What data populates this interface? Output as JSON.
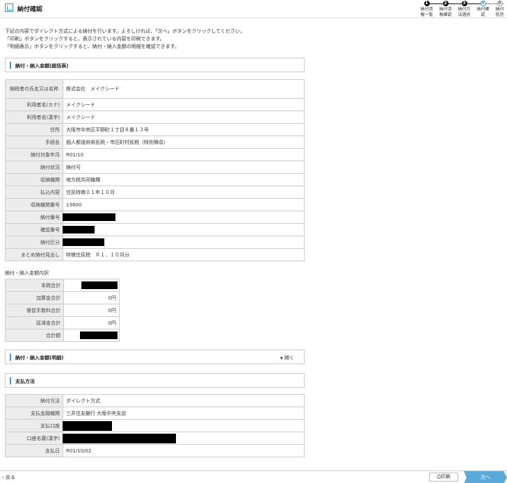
{
  "header": {
    "title": "納付確認"
  },
  "steps": [
    {
      "num": "1",
      "line1": "納付済",
      "line2": "報一覧"
    },
    {
      "num": "2",
      "line1": "納付済",
      "line2": "報確認"
    },
    {
      "num": "3",
      "line1": "納付方",
      "line2": "法選択"
    },
    {
      "num": "4",
      "line1": "納付確",
      "line2": "認"
    },
    {
      "num": "5",
      "line1": "納付",
      "line2": "低完"
    }
  ],
  "intro": {
    "line1": "下記の内容でダイレクト方式による納付を行います。よろしければ、「次へ」ボタンをクリックしてください。",
    "line2": "「印刷」ボタンをクリックすると、表示されている内容を印刷できます。",
    "line3": "「明細表示」ボタンをクリックすると、納付・納入金額の明細を確認できます。"
  },
  "section_summary": {
    "title": "納付・納入金額(総括表)"
  },
  "summary_rows": [
    {
      "label": "納税者の氏名又は名称",
      "value": "株式会社　メイクシード"
    },
    {
      "label": "利用者名(カナ)",
      "value": "メイクシード"
    },
    {
      "label": "利用者名(漢字)",
      "value": "メイクシード"
    },
    {
      "label": "住所",
      "value": "大阪市中央区平野町１丁目８番１３号"
    },
    {
      "label": "手続名",
      "value": "個人都道府県民税・市区町村民税（特別徴収）"
    },
    {
      "label": "納付対象年月",
      "value": "R01/10"
    },
    {
      "label": "納付状況",
      "value": "納付可"
    },
    {
      "label": "収納機関",
      "value": "地方税共同機構"
    },
    {
      "label": "払込内容",
      "value": "住民特徴０１年１０月"
    },
    {
      "label": "収納機関番号",
      "value": "13800"
    },
    {
      "label": "納付番号",
      "value": ""
    },
    {
      "label": "確認番号",
      "value": ""
    },
    {
      "label": "納付区分",
      "value": ""
    },
    {
      "label": "まとめ納付見出し",
      "value": "特徴住民税　Ｒ１．１０月分"
    }
  ],
  "breakdown": {
    "title": "納付・納入金額内訳",
    "rows": [
      {
        "label": "本税合計",
        "value": ""
      },
      {
        "label": "加算金合計",
        "value": "0円"
      },
      {
        "label": "督促手数料合計",
        "value": "0円"
      },
      {
        "label": "延滞金合計",
        "value": "0円"
      },
      {
        "label": "合計額",
        "value": ""
      }
    ]
  },
  "section_detail": {
    "title": "納付・納入金額(明細)",
    "toggle": "開く"
  },
  "section_payment": {
    "title": "支払方法"
  },
  "payment_rows": [
    {
      "label": "納付方法",
      "value": "ダイレクト方式"
    },
    {
      "label": "支払金融機関",
      "value": "三井住友銀行 大阪中央支店"
    },
    {
      "label": "支払口座",
      "value": ""
    },
    {
      "label": "口座名義(漢字)",
      "value": ""
    },
    {
      "label": "支払日",
      "value": "R01/10/02"
    }
  ],
  "footer": {
    "back": "戻る",
    "print": "印刷",
    "next": "次へ"
  },
  "colors": {
    "accent": "#3a9fd0",
    "next_button": "#5aa9d8",
    "label_bg": "#ececec"
  }
}
